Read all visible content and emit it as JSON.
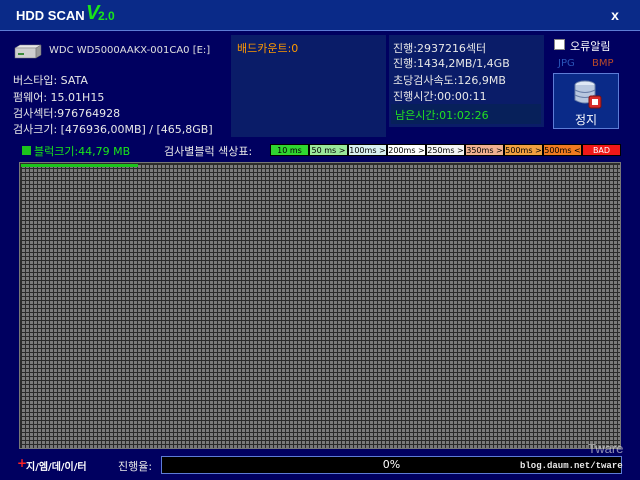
{
  "title": {
    "app": "HDD SCAN",
    "v": "V",
    "ver": "2.0",
    "close": "x"
  },
  "drive": {
    "name": "WDC WD5000AAKX-001CA0 [E:]",
    "bus": "버스타입: SATA",
    "firmware": "펌웨어: 15.01H15",
    "sectors": "검사섹터:976764928",
    "size": "검사크기: [476936,00MB] / [465,8GB]"
  },
  "bad_count": "배드카운트:0",
  "progress_info": {
    "sector": "진행:2937216섹터",
    "mb": "진행:1434,2MB/1,4GB",
    "speed": "초당검사속도:126,9MB",
    "elapsed": "진행시간:00:00:11",
    "remaining": "남은시간:01:02:26"
  },
  "options": {
    "error_alarm": "오류알림",
    "error_alarm_checked": false,
    "jpg": "JPG",
    "bmp": "BMP"
  },
  "stop_button": {
    "label": "정지",
    "icon": "database-stop-icon"
  },
  "block_size": "블럭크기:44,79 MB",
  "legend_title": "검사별블럭 색상표:",
  "legend": [
    {
      "label": "10 ms",
      "color": "#30d630"
    },
    {
      "label": "50 ms >",
      "color": "#9ae89a"
    },
    {
      "label": "100ms >",
      "color": "#d8f0f0"
    },
    {
      "label": "200ms >",
      "color": "#ffffff"
    },
    {
      "label": "250ms >",
      "color": "#f4f4f4"
    },
    {
      "label": "350ms >",
      "color": "#f0b090"
    },
    {
      "label": "500ms >",
      "color": "#f0a040"
    },
    {
      "label": "500ms <",
      "color": "#f07a20"
    },
    {
      "label": "BAD",
      "color": "#f01818"
    }
  ],
  "colors": {
    "done_block": "#1cc41c",
    "pending_block": "#7a7a7a"
  },
  "scan_grid": {
    "completed_fraction": 0.01
  },
  "watermark": "Tware",
  "footer": {
    "plus": "+",
    "brand": "지/엠/데/이/터",
    "progress_label": "진행율:",
    "progress_text": "0%",
    "progress_fraction": 0,
    "blog": "blog.daum.net/tware"
  }
}
